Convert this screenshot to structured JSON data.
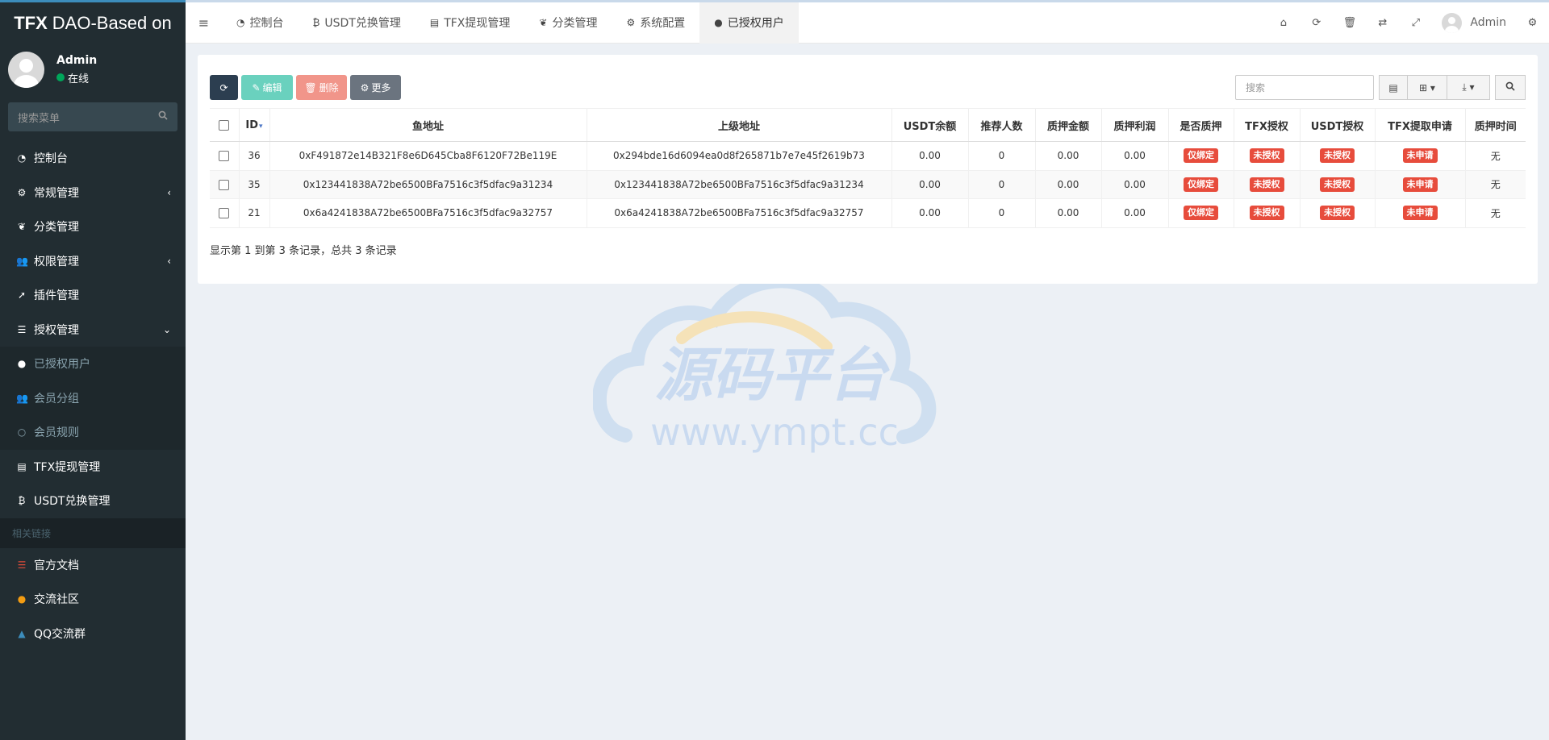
{
  "app": {
    "brand_bold": "TFX",
    "brand_rest": "DAO-Based on"
  },
  "user": {
    "name": "Admin",
    "status": "在线"
  },
  "sidebar": {
    "search_placeholder": "搜索菜单",
    "items": [
      {
        "label": "控制台",
        "icon": "dashboard-icon"
      },
      {
        "label": "常规管理",
        "icon": "cogs-icon"
      },
      {
        "label": "分类管理",
        "icon": "leaf-icon"
      },
      {
        "label": "权限管理",
        "icon": "users-icon"
      },
      {
        "label": "插件管理",
        "icon": "rocket-icon"
      },
      {
        "label": "授权管理",
        "icon": "list-icon"
      }
    ],
    "sub_items": [
      {
        "label": "已授权用户",
        "icon": "user-icon"
      },
      {
        "label": "会员分组",
        "icon": "users-icon"
      },
      {
        "label": "会员规则",
        "icon": "circle-icon"
      }
    ],
    "items2": [
      {
        "label": "TFX提现管理",
        "icon": "id-card-icon"
      },
      {
        "label": "USDT兑换管理",
        "icon": "bitcoin-icon"
      }
    ],
    "header": "相关链接",
    "links": [
      {
        "label": "官方文档",
        "icon": "list-icon",
        "color": "#dd4b39"
      },
      {
        "label": "交流社区",
        "icon": "comment-icon",
        "color": "#f39c12"
      },
      {
        "label": "QQ交流群",
        "icon": "qq-icon",
        "color": "#3c8dbc"
      }
    ]
  },
  "tabs": [
    {
      "label": "控制台"
    },
    {
      "label": "USDT兑换管理"
    },
    {
      "label": "TFX提现管理"
    },
    {
      "label": "分类管理"
    },
    {
      "label": "系统配置"
    },
    {
      "label": "已授权用户"
    }
  ],
  "topnav": {
    "user_name": "Admin"
  },
  "toolbar": {
    "edit_label": "编辑",
    "delete_label": "删除",
    "more_label": "更多",
    "search_placeholder": "搜索"
  },
  "table": {
    "columns": [
      "ID",
      "鱼地址",
      "上级地址",
      "USDT余额",
      "推荐人数",
      "质押金额",
      "质押利润",
      "是否质押",
      "TFX授权",
      "USDT授权",
      "TFX提取申请",
      "质押时间"
    ],
    "rows": [
      {
        "id": "36",
        "addr": "0xF491872e14B321F8e6D645Cba8F6120F72Be119E",
        "parent": "0x294bde16d6094ea0d8f265871b7e7e45f2619b73",
        "usdt": "0.00",
        "refs": "0",
        "stake": "0.00",
        "profit": "0.00",
        "staked": "仅绑定",
        "tfx_auth": "未授权",
        "usdt_auth": "未授权",
        "withdraw": "未申请",
        "time": "无"
      },
      {
        "id": "35",
        "addr": "0x123441838A72be6500BFa7516c3f5dfac9a31234",
        "parent": "0x123441838A72be6500BFa7516c3f5dfac9a31234",
        "usdt": "0.00",
        "refs": "0",
        "stake": "0.00",
        "profit": "0.00",
        "staked": "仅绑定",
        "tfx_auth": "未授权",
        "usdt_auth": "未授权",
        "withdraw": "未申请",
        "time": "无"
      },
      {
        "id": "21",
        "addr": "0x6a4241838A72be6500BFa7516c3f5dfac9a32757",
        "parent": "0x6a4241838A72be6500BFa7516c3f5dfac9a32757",
        "usdt": "0.00",
        "refs": "0",
        "stake": "0.00",
        "profit": "0.00",
        "staked": "仅绑定",
        "tfx_auth": "未授权",
        "usdt_auth": "未授权",
        "withdraw": "未申请",
        "time": "无"
      }
    ]
  },
  "pager": {
    "info": "显示第 1 到第 3 条记录，总共 3 条记录"
  },
  "watermark": {
    "title": "源码平台",
    "url": "www.ympt.cc"
  },
  "colors": {
    "accent": "#4e77c6",
    "sidebar_bg": "#222d32",
    "danger": "#e74c3c"
  }
}
